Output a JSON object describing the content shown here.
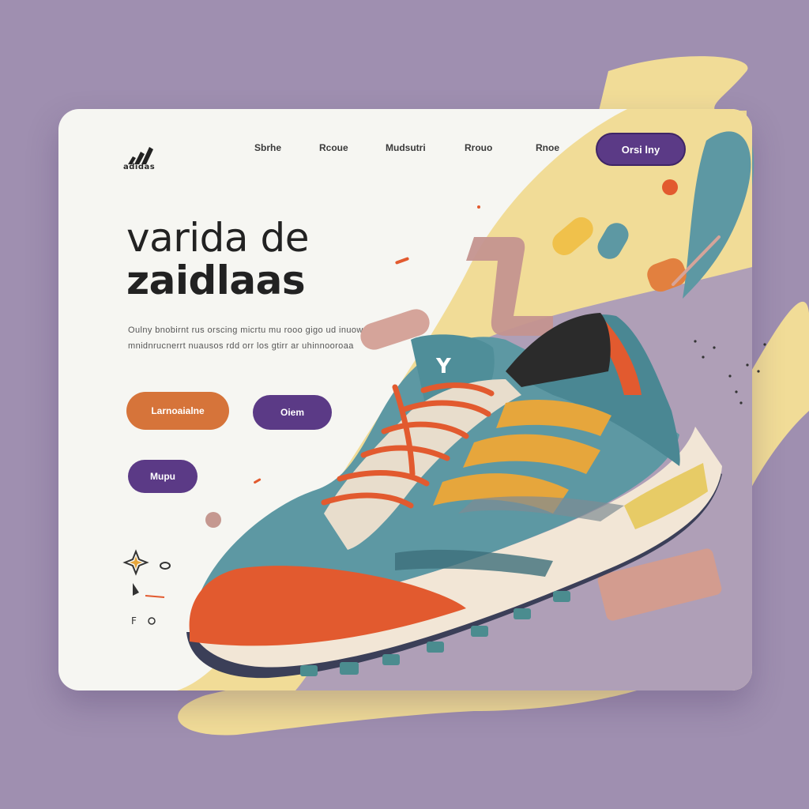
{
  "brand": {
    "name": "adidas",
    "logo_icon": "three-stripes-logo-icon"
  },
  "nav": {
    "items": [
      {
        "label": "Sbrhe",
        "id": "nav-item-1"
      },
      {
        "label": "Rcoue",
        "id": "nav-item-2"
      },
      {
        "label": "Mudsutri",
        "id": "nav-item-3"
      },
      {
        "label": "Rrouo",
        "id": "nav-item-4"
      },
      {
        "label": "Rnoe",
        "id": "nav-item-5"
      }
    ]
  },
  "header_cta": {
    "label": "Orsi lny"
  },
  "hero": {
    "title_line1": "varida de",
    "title_line2": "zaidlaas",
    "description": "Oulny bnobirnt rus orscing micrtu mu rooo gigo ud inuow mnidnrucnerrt nuausos rdd orr los gtirr ar uhinnooroaa"
  },
  "buttons": {
    "primary": "Larnoaialne",
    "secondary": "Oiem",
    "tertiary": "Mupu"
  },
  "colors": {
    "background": "#9f8fb0",
    "card": "#f6f6f2",
    "accent_purple": "#5b3a86",
    "accent_orange": "#d6743a",
    "blob_yellow": "#f1dc97",
    "shoe_teal": "#5d98a3",
    "shoe_orange": "#e25a2f",
    "shoe_gold": "#e6a63c"
  },
  "hero_image": {
    "subject": "running-sneaker-illustration"
  }
}
